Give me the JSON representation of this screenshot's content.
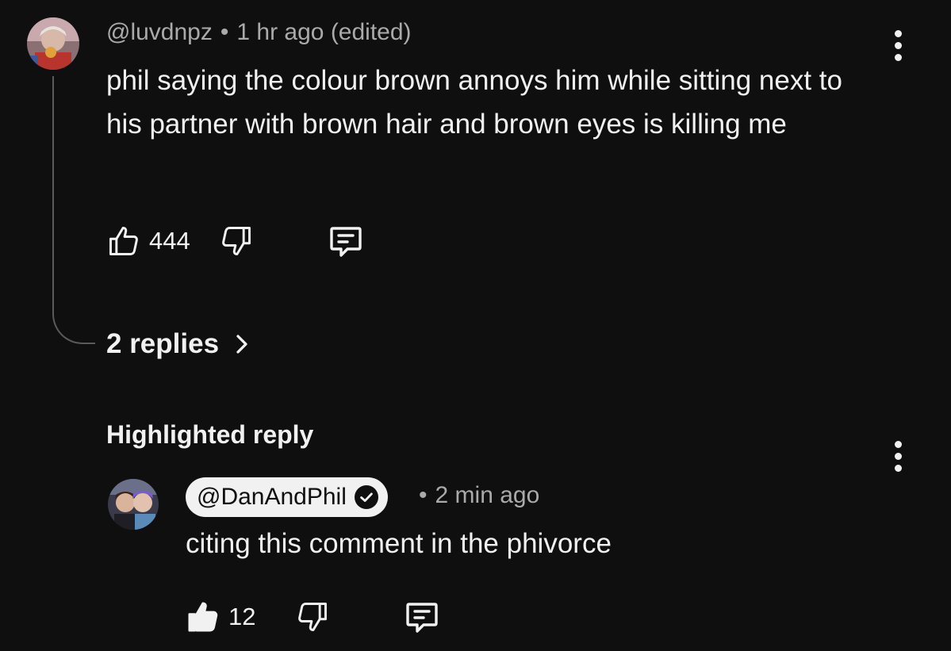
{
  "comment": {
    "username": "@luvdnpz",
    "separator": "•",
    "time": "1 hr ago",
    "edited": "(edited)",
    "text": "phil saying the colour brown annoys him while sitting next to his partner with brown hair and brown eyes is killing me",
    "likes": "444",
    "replies_label": "2 replies"
  },
  "highlighted": {
    "section_label": "Highlighted reply",
    "username": "@DanAndPhil",
    "separator": "•",
    "time": "2 min ago",
    "text": "citing this comment in the phivorce",
    "likes": "12"
  },
  "icons": {
    "like": "thumbs-up-outline-icon",
    "like_filled": "thumbs-up-filled-icon",
    "dislike": "thumbs-down-outline-icon",
    "reply": "comment-bubble-icon",
    "more": "kebab-menu-icon",
    "verified": "verified-check-icon",
    "chevron": "chevron-right-icon"
  },
  "colors": {
    "background": "#0f0f0f",
    "text": "#f1f1f1",
    "meta": "#aaaaaa",
    "thread_line": "#5a5a5a"
  }
}
